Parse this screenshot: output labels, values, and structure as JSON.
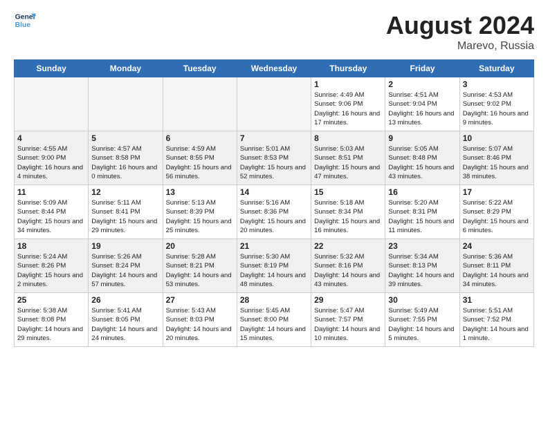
{
  "header": {
    "logo_line1": "General",
    "logo_line2": "Blue",
    "month_year": "August 2024",
    "location": "Marevo, Russia"
  },
  "weekdays": [
    "Sunday",
    "Monday",
    "Tuesday",
    "Wednesday",
    "Thursday",
    "Friday",
    "Saturday"
  ],
  "weeks": [
    [
      {
        "day": "",
        "empty": true
      },
      {
        "day": "",
        "empty": true
      },
      {
        "day": "",
        "empty": true
      },
      {
        "day": "",
        "empty": true
      },
      {
        "day": "1",
        "sunrise": "4:49 AM",
        "sunset": "9:06 PM",
        "daylight": "16 hours and 17 minutes."
      },
      {
        "day": "2",
        "sunrise": "4:51 AM",
        "sunset": "9:04 PM",
        "daylight": "16 hours and 13 minutes."
      },
      {
        "day": "3",
        "sunrise": "4:53 AM",
        "sunset": "9:02 PM",
        "daylight": "16 hours and 9 minutes."
      }
    ],
    [
      {
        "day": "4",
        "sunrise": "4:55 AM",
        "sunset": "9:00 PM",
        "daylight": "16 hours and 4 minutes."
      },
      {
        "day": "5",
        "sunrise": "4:57 AM",
        "sunset": "8:58 PM",
        "daylight": "16 hours and 0 minutes."
      },
      {
        "day": "6",
        "sunrise": "4:59 AM",
        "sunset": "8:55 PM",
        "daylight": "15 hours and 56 minutes."
      },
      {
        "day": "7",
        "sunrise": "5:01 AM",
        "sunset": "8:53 PM",
        "daylight": "15 hours and 52 minutes."
      },
      {
        "day": "8",
        "sunrise": "5:03 AM",
        "sunset": "8:51 PM",
        "daylight": "15 hours and 47 minutes."
      },
      {
        "day": "9",
        "sunrise": "5:05 AM",
        "sunset": "8:48 PM",
        "daylight": "15 hours and 43 minutes."
      },
      {
        "day": "10",
        "sunrise": "5:07 AM",
        "sunset": "8:46 PM",
        "daylight": "15 hours and 38 minutes."
      }
    ],
    [
      {
        "day": "11",
        "sunrise": "5:09 AM",
        "sunset": "8:44 PM",
        "daylight": "15 hours and 34 minutes."
      },
      {
        "day": "12",
        "sunrise": "5:11 AM",
        "sunset": "8:41 PM",
        "daylight": "15 hours and 29 minutes."
      },
      {
        "day": "13",
        "sunrise": "5:13 AM",
        "sunset": "8:39 PM",
        "daylight": "15 hours and 25 minutes."
      },
      {
        "day": "14",
        "sunrise": "5:16 AM",
        "sunset": "8:36 PM",
        "daylight": "15 hours and 20 minutes."
      },
      {
        "day": "15",
        "sunrise": "5:18 AM",
        "sunset": "8:34 PM",
        "daylight": "15 hours and 16 minutes."
      },
      {
        "day": "16",
        "sunrise": "5:20 AM",
        "sunset": "8:31 PM",
        "daylight": "15 hours and 11 minutes."
      },
      {
        "day": "17",
        "sunrise": "5:22 AM",
        "sunset": "8:29 PM",
        "daylight": "15 hours and 6 minutes."
      }
    ],
    [
      {
        "day": "18",
        "sunrise": "5:24 AM",
        "sunset": "8:26 PM",
        "daylight": "15 hours and 2 minutes."
      },
      {
        "day": "19",
        "sunrise": "5:26 AM",
        "sunset": "8:24 PM",
        "daylight": "14 hours and 57 minutes."
      },
      {
        "day": "20",
        "sunrise": "5:28 AM",
        "sunset": "8:21 PM",
        "daylight": "14 hours and 53 minutes."
      },
      {
        "day": "21",
        "sunrise": "5:30 AM",
        "sunset": "8:19 PM",
        "daylight": "14 hours and 48 minutes."
      },
      {
        "day": "22",
        "sunrise": "5:32 AM",
        "sunset": "8:16 PM",
        "daylight": "14 hours and 43 minutes."
      },
      {
        "day": "23",
        "sunrise": "5:34 AM",
        "sunset": "8:13 PM",
        "daylight": "14 hours and 39 minutes."
      },
      {
        "day": "24",
        "sunrise": "5:36 AM",
        "sunset": "8:11 PM",
        "daylight": "14 hours and 34 minutes."
      }
    ],
    [
      {
        "day": "25",
        "sunrise": "5:38 AM",
        "sunset": "8:08 PM",
        "daylight": "14 hours and 29 minutes."
      },
      {
        "day": "26",
        "sunrise": "5:41 AM",
        "sunset": "8:05 PM",
        "daylight": "14 hours and 24 minutes."
      },
      {
        "day": "27",
        "sunrise": "5:43 AM",
        "sunset": "8:03 PM",
        "daylight": "14 hours and 20 minutes."
      },
      {
        "day": "28",
        "sunrise": "5:45 AM",
        "sunset": "8:00 PM",
        "daylight": "14 hours and 15 minutes."
      },
      {
        "day": "29",
        "sunrise": "5:47 AM",
        "sunset": "7:57 PM",
        "daylight": "14 hours and 10 minutes."
      },
      {
        "day": "30",
        "sunrise": "5:49 AM",
        "sunset": "7:55 PM",
        "daylight": "14 hours and 5 minutes."
      },
      {
        "day": "31",
        "sunrise": "5:51 AM",
        "sunset": "7:52 PM",
        "daylight": "14 hours and 1 minute."
      }
    ]
  ],
  "labels": {
    "sunrise": "Sunrise:",
    "sunset": "Sunset:",
    "daylight": "Daylight:"
  }
}
